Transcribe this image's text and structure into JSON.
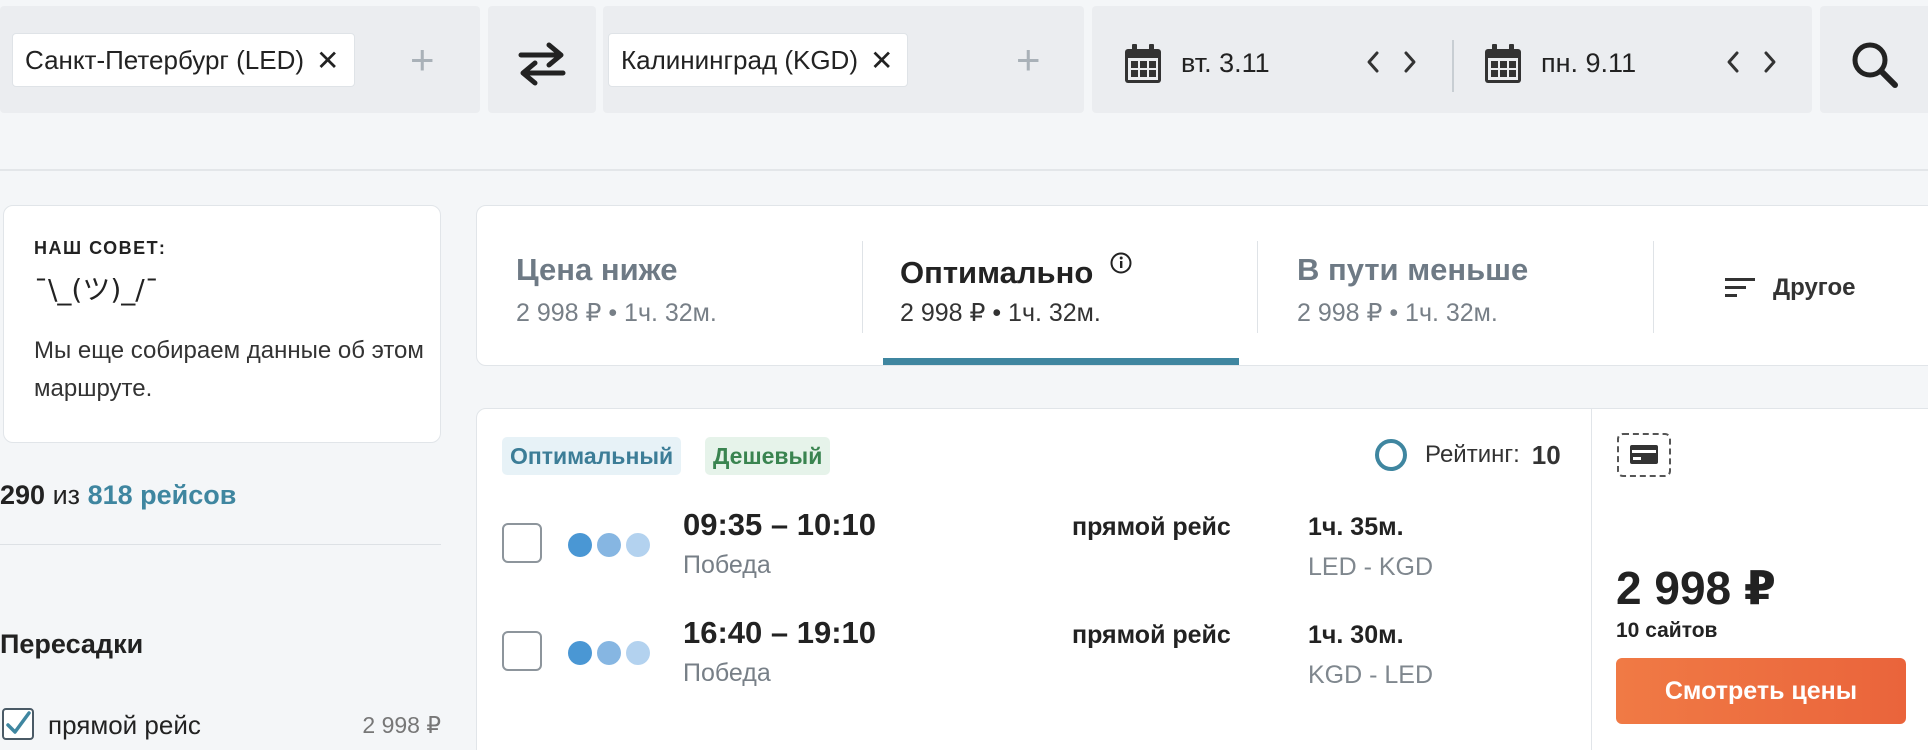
{
  "search": {
    "origin": "Санкт-Петербург (LED)",
    "destination": "Калининград (KGD)",
    "add_symbol": "+",
    "remove_symbol": "✕",
    "depart_date": "вт. 3.11",
    "return_date": "пн. 9.11"
  },
  "advice": {
    "heading": "НАШ СОВЕТ:",
    "shrug": "¯\\_(ツ)_/¯",
    "text": "Мы еще собираем данные об этом маршруте."
  },
  "results": {
    "shown": "290",
    "of": "из",
    "total_link": "818 рейсов"
  },
  "filters": {
    "transfers_heading": "Пересадки",
    "direct_label": "прямой рейс",
    "direct_price": "2 998 ₽",
    "direct_checked": true
  },
  "sort_tabs": [
    {
      "title": "Цена ниже",
      "sub": "2 998 ₽ • 1ч. 32м.",
      "active": false
    },
    {
      "title": "Оптимально",
      "sub": "2 998 ₽ • 1ч. 32м.",
      "active": true
    },
    {
      "title": "В пути меньше",
      "sub": "2 998 ₽ • 1ч. 32м.",
      "active": false
    }
  ],
  "other_label": "Другое",
  "ticket": {
    "badges": [
      "Оптимальный",
      "Дешевый"
    ],
    "rating_label": "Рейтинг:",
    "rating_value": "10",
    "segments": [
      {
        "time": "09:35 – 10:10",
        "airline": "Победа",
        "type": "прямой рейс",
        "duration": "1ч. 35м.",
        "route": "LED - KGD"
      },
      {
        "time": "16:40 – 19:10",
        "airline": "Победа",
        "type": "прямой рейс",
        "duration": "1ч. 30м.",
        "route": "KGD - LED"
      }
    ],
    "price": "2 998 ₽",
    "sites": "10 сайтов",
    "cta": "Смотреть цены"
  },
  "colors": {
    "accent": "#3f86a0",
    "cta": "#ea643b",
    "dot_1": "#4a97d4",
    "dot_2": "#86b6e2",
    "dot_3": "#b3d2ef"
  }
}
